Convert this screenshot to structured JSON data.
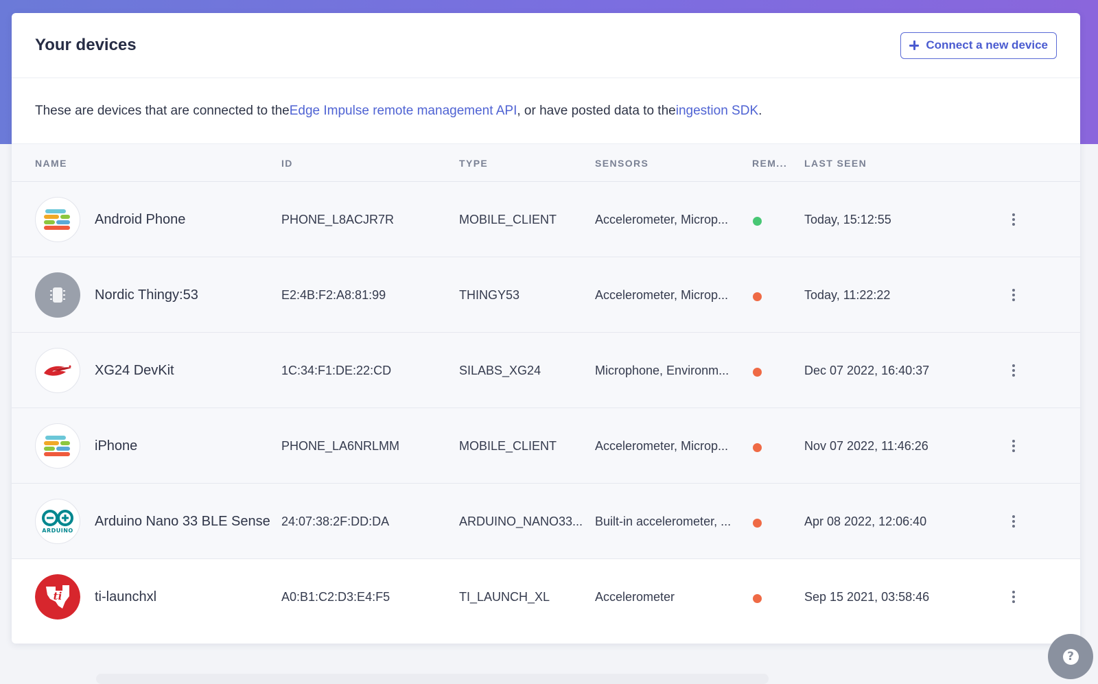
{
  "header": {
    "title": "Your devices",
    "connect_label": "Connect a new device"
  },
  "intro": {
    "text_before": "These are devices that are connected to the ",
    "link_remote": "Edge Impulse remote management API",
    "text_middle": ", or have posted data to the ",
    "link_sdk": "ingestion SDK",
    "text_after": "."
  },
  "columns": {
    "name": "NAME",
    "id": "ID",
    "type": "TYPE",
    "sensors": "SENSORS",
    "remote": "REM...",
    "last_seen": "LAST SEEN"
  },
  "devices": [
    {
      "name": "Android Phone",
      "id": "PHONE_L8ACJR7R",
      "type": "MOBILE_CLIENT",
      "sensors": "Accelerometer, Microp...",
      "remote_connected": true,
      "status_color": "#48c774",
      "last_seen": "Today, 15:12:55",
      "icon": "edge-impulse-logo-icon"
    },
    {
      "name": "Nordic Thingy:53",
      "id": "E2:4B:F2:A8:81:99",
      "type": "THINGY53",
      "sensors": "Accelerometer, Microp...",
      "remote_connected": false,
      "status_color": "#ef6a45",
      "last_seen": "Today, 11:22:22",
      "icon": "chip-icon"
    },
    {
      "name": "XG24 DevKit",
      "id": "1C:34:F1:DE:22:CD",
      "type": "SILABS_XG24",
      "sensors": "Microphone, Environm...",
      "remote_connected": false,
      "status_color": "#ef6a45",
      "last_seen": "Dec 07 2022, 16:40:37",
      "icon": "silabs-logo-icon"
    },
    {
      "name": "iPhone",
      "id": "PHONE_LA6NRLMM",
      "type": "MOBILE_CLIENT",
      "sensors": "Accelerometer, Microp...",
      "remote_connected": false,
      "status_color": "#ef6a45",
      "last_seen": "Nov 07 2022, 11:46:26",
      "icon": "edge-impulse-logo-icon"
    },
    {
      "name": "Arduino Nano 33 BLE Sense",
      "id": "24:07:38:2F:DD:DA",
      "type": "ARDUINO_NANO33...",
      "sensors": "Built-in accelerometer, ...",
      "remote_connected": false,
      "status_color": "#ef6a45",
      "last_seen": "Apr 08 2022, 12:06:40",
      "icon": "arduino-logo-icon",
      "icon_text": "ARDUINO"
    },
    {
      "name": "ti-launchxl",
      "id": "A0:B1:C2:D3:E4:F5",
      "type": "TI_LAUNCH_XL",
      "sensors": "Accelerometer",
      "remote_connected": false,
      "status_color": "#ef6a45",
      "last_seen": "Sep 15 2021, 03:58:46",
      "icon": "texas-instruments-logo-icon",
      "icon_text": "ti"
    }
  ],
  "colors": {
    "accent": "#4a5bd0",
    "connected": "#48c774",
    "disconnected": "#ef6a45",
    "band_start": "#6b7ad8",
    "band_end": "#8a66dc"
  },
  "help": {
    "icon": "question-icon",
    "glyph": "?"
  }
}
